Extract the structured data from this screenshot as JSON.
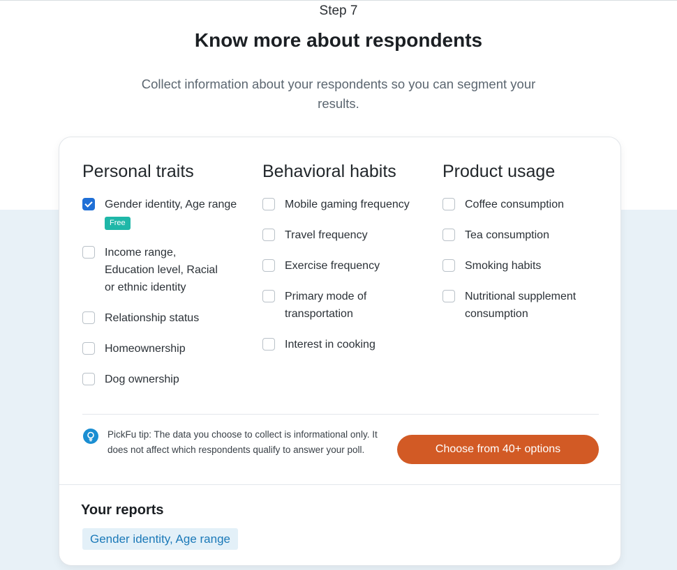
{
  "header": {
    "step": "Step 7",
    "title": "Know more about respondents",
    "subtitle": "Collect information about your respondents so you can segment your results."
  },
  "columns": [
    {
      "heading": "Personal traits",
      "options": [
        {
          "label": "Gender identity, Age range",
          "checked": true,
          "badge": "Free"
        },
        {
          "label": "Income range, Education level, Racial or ethnic identity",
          "checked": false
        },
        {
          "label": "Relationship status",
          "checked": false
        },
        {
          "label": "Homeownership",
          "checked": false
        },
        {
          "label": "Dog ownership",
          "checked": false
        }
      ]
    },
    {
      "heading": "Behavioral habits",
      "options": [
        {
          "label": "Mobile gaming frequency",
          "checked": false
        },
        {
          "label": "Travel frequency",
          "checked": false
        },
        {
          "label": "Exercise frequency",
          "checked": false
        },
        {
          "label": "Primary mode of transportation",
          "checked": false
        },
        {
          "label": "Interest in cooking",
          "checked": false
        }
      ]
    },
    {
      "heading": "Product usage",
      "options": [
        {
          "label": "Coffee consumption",
          "checked": false
        },
        {
          "label": "Tea consumption",
          "checked": false
        },
        {
          "label": "Smoking habits",
          "checked": false
        },
        {
          "label": "Nutritional supplement consumption",
          "checked": false
        }
      ]
    }
  ],
  "tip": {
    "icon": "lightbulb-icon",
    "text": "PickFu tip: The data you choose to collect is informational only. It does not affect which respondents qualify to answer your poll."
  },
  "cta": {
    "label": "Choose from 40+ options"
  },
  "reports": {
    "heading": "Your reports",
    "items": [
      "Gender identity, Age range"
    ]
  },
  "colors": {
    "accent_button": "#d25a25",
    "checkbox_checked": "#1f6fd6",
    "free_badge": "#1fb7a8",
    "tip_icon": "#1a8ed2",
    "report_chip_bg": "#e3f0f8",
    "report_chip_text": "#1b79b8",
    "page_bottom_bg": "#e8f1f7"
  }
}
